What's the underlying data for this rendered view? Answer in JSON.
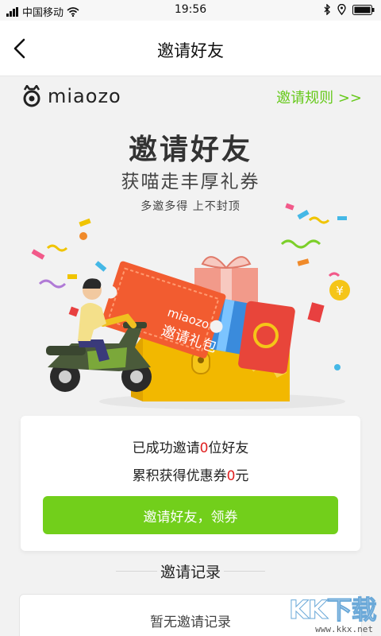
{
  "status_bar": {
    "carrier": "中国移动",
    "time": "19:56"
  },
  "nav": {
    "title": "邀请好友"
  },
  "brand": {
    "name": "miaozo",
    "rules_link": "邀请规则 >>",
    "accent_color": "#66c91a"
  },
  "hero": {
    "title": "邀请好友",
    "subtitle": "获喵走丰厚礼券",
    "tagline": "多邀多得 上不封顶",
    "ticket_brand": "miaozo",
    "ticket_text": "邀请礼包"
  },
  "stats": {
    "invited_prefix": "已成功邀请",
    "invited_count": "0",
    "invited_suffix": "位好友",
    "coupon_prefix": "累积获得优惠券",
    "coupon_amount": "0",
    "coupon_suffix": "元",
    "highlight_color": "#e02020"
  },
  "invite_button": {
    "label": "邀请好友，领券",
    "color": "#72cf1b"
  },
  "records": {
    "heading": "邀请记录",
    "empty_text": "暂无邀请记录"
  },
  "watermark": {
    "text": "KK下载",
    "url": "www.kkx.net"
  }
}
